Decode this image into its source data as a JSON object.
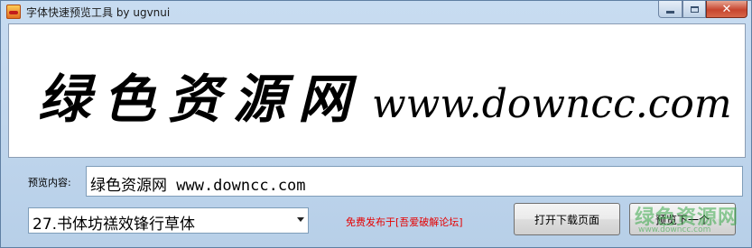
{
  "window": {
    "title": "字体快速预览工具 by ugvnui",
    "close_symbol": "✕"
  },
  "preview": {
    "chinese_text": "绿色资源网",
    "url_text": "www.downcc.com"
  },
  "form": {
    "preview_label": "预览内容:",
    "preview_value": "绿色资源网 www.downcc.com",
    "font_selected": "27.书体坊禚效锋行草体"
  },
  "footer": {
    "release_text": "免费发布于[吾爱破解论坛]",
    "open_download_label": "打开下载页面",
    "next_label": "预览下一个"
  },
  "watermark": {
    "text": "绿色资源网",
    "url": "www.downcc.com"
  },
  "colors": {
    "accent_red": "#e60000",
    "watermark_green": "#39a848",
    "window_blue": "#b7cfe8"
  }
}
